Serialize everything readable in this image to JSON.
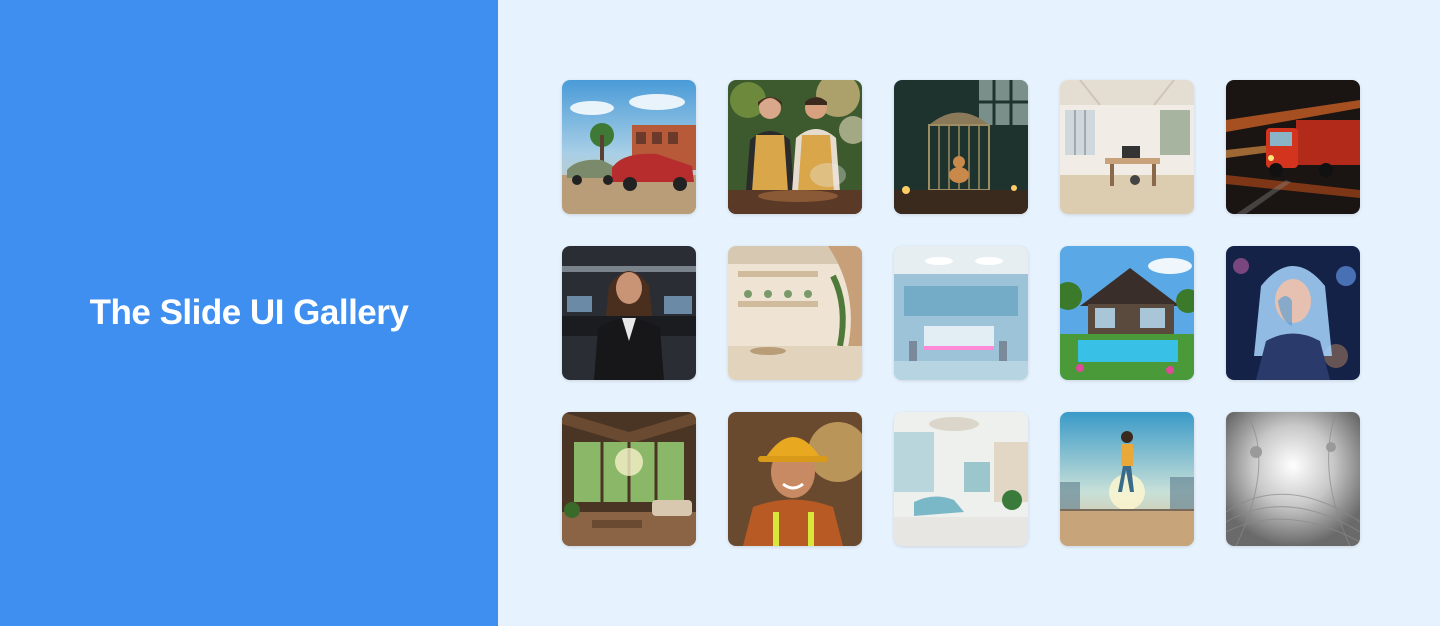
{
  "title": "The Slide UI Gallery",
  "colors": {
    "accent": "#3f8ff1",
    "background": "#e6f2fd",
    "title_text": "#ffffff"
  },
  "gallery": {
    "items": [
      {
        "name": "vintage-cars-street-image"
      },
      {
        "name": "couple-cooking-outdoors-image"
      },
      {
        "name": "dog-in-cage-room-image"
      },
      {
        "name": "bright-loft-office-image"
      },
      {
        "name": "speeding-red-truck-image"
      },
      {
        "name": "businesswoman-portrait-image"
      },
      {
        "name": "modern-lobby-interior-image"
      },
      {
        "name": "futuristic-lab-interior-image"
      },
      {
        "name": "modern-house-pool-image"
      },
      {
        "name": "glowing-woman-portrait-image"
      },
      {
        "name": "sunlit-living-room-image"
      },
      {
        "name": "construction-worker-portrait-image"
      },
      {
        "name": "dental-clinic-interior-image"
      },
      {
        "name": "woman-running-bridge-image"
      },
      {
        "name": "abstract-tech-tunnel-image"
      }
    ]
  }
}
